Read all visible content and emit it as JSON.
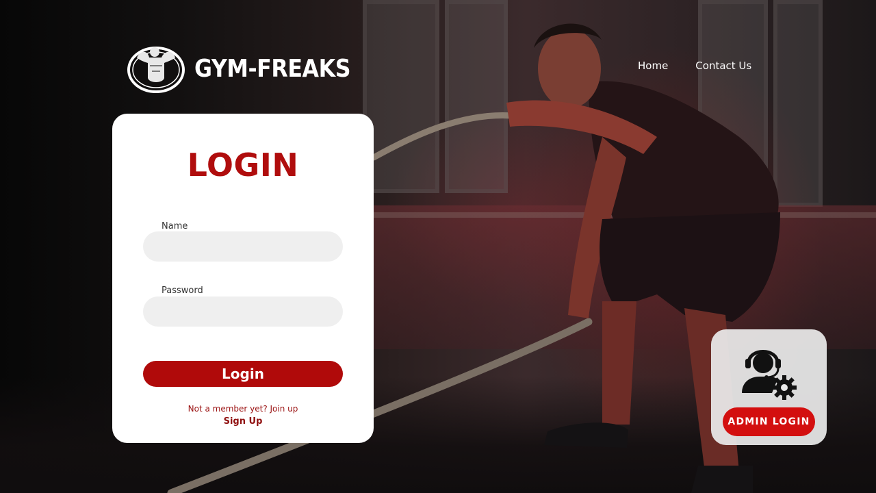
{
  "brand": {
    "name": "GYM-FREAKS",
    "logo_icon": "bodybuilder-logo-icon"
  },
  "nav": {
    "items": [
      {
        "label": "Home"
      },
      {
        "label": "Contact Us"
      }
    ]
  },
  "login_form": {
    "title": "LOGIN",
    "name_label": "Name",
    "name_value": "",
    "password_label": "Password",
    "password_value": "",
    "submit_label": "Login",
    "signup_prompt": "Not a member yet? Join up",
    "signup_link": "Sign Up"
  },
  "admin": {
    "icon": "support-agent-gear-icon",
    "button_label": "ADMIN LOGIN"
  },
  "colors": {
    "accent": "#b00a0a",
    "admin_button": "#d30f0f",
    "card": "#ffffff"
  }
}
